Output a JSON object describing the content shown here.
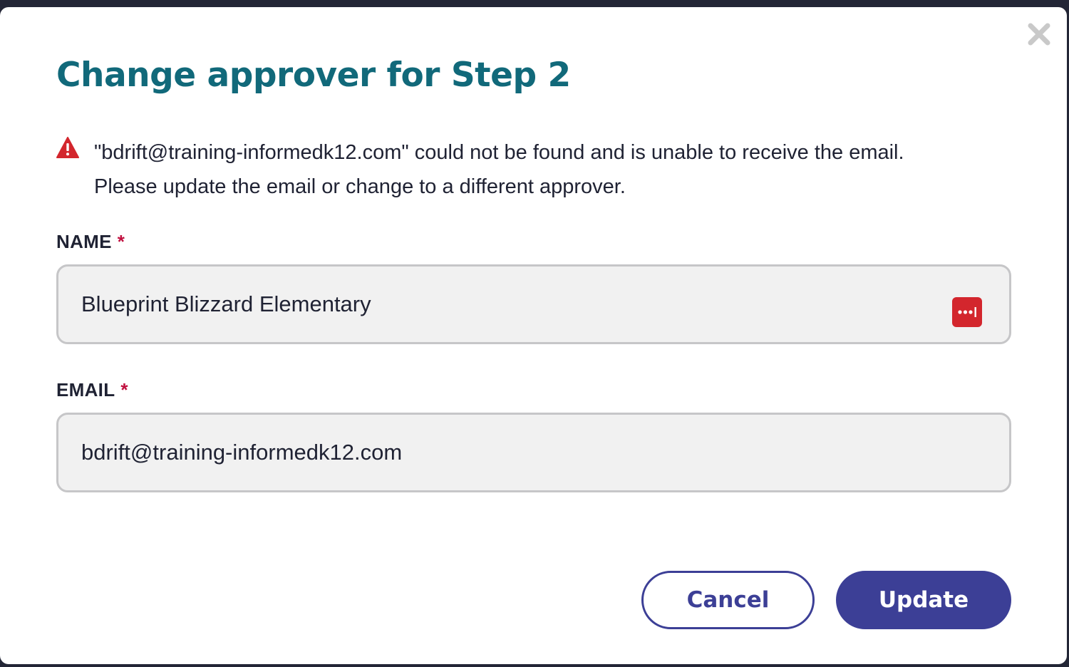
{
  "dialog": {
    "title": "Change approver for Step 2",
    "close_icon": "close-icon",
    "warning": {
      "icon": "warning-triangle-icon",
      "line1": "\"bdrift@training-informedk12.com\" could not be found and is unable to receive the email.",
      "line2": "Please update the email or change to a different approver."
    },
    "name_field": {
      "label": "NAME",
      "required_marker": "*",
      "value": "Blueprint Blizzard Elementary",
      "addon_icon": "password-manager-icon"
    },
    "email_field": {
      "label": "EMAIL",
      "required_marker": "*",
      "value": "bdrift@training-informedk12.com"
    },
    "buttons": {
      "cancel": "Cancel",
      "update": "Update"
    }
  },
  "colors": {
    "title": "#11697a",
    "primary": "#3c3f96",
    "required": "#c0103f",
    "warning": "#d3262d",
    "input_bg": "#f1f1f1",
    "backdrop": "#232636"
  }
}
